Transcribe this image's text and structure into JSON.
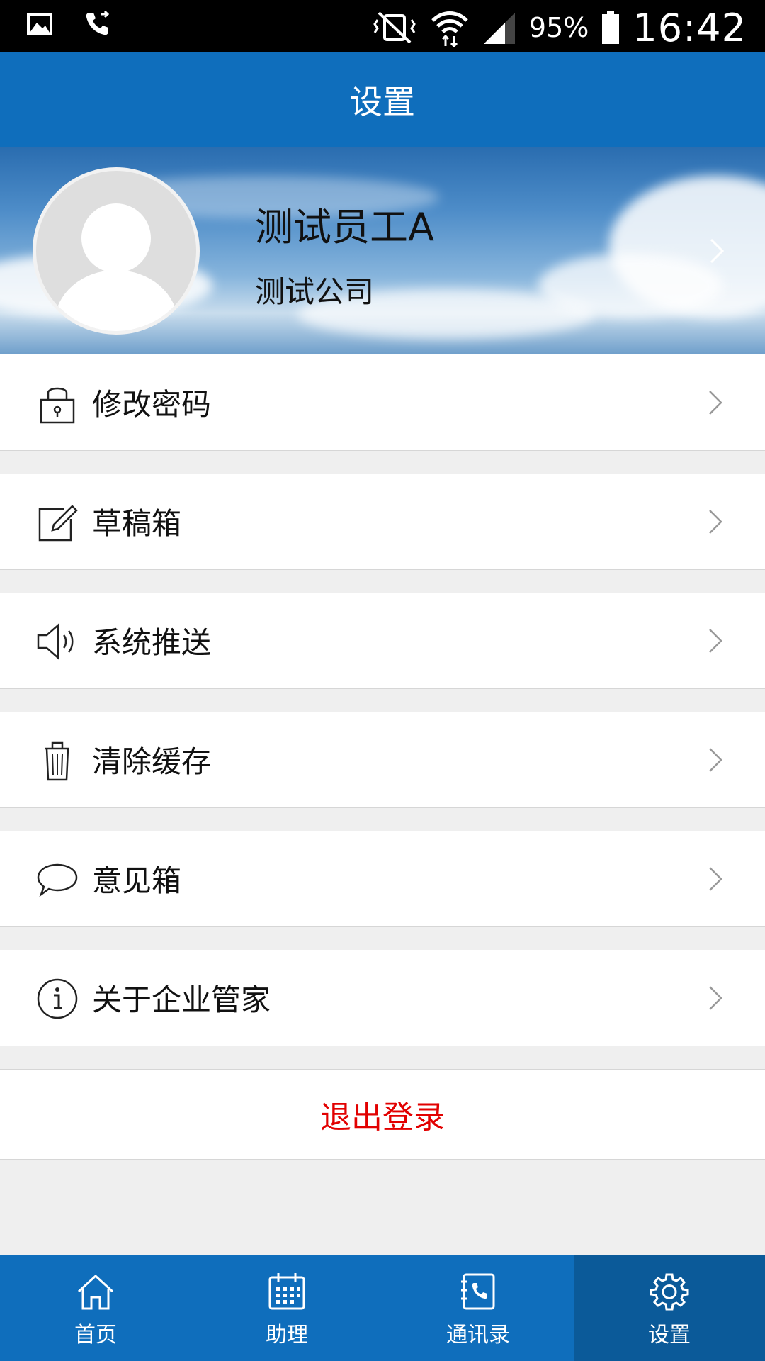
{
  "status_bar": {
    "battery": "95%",
    "time": "16:42"
  },
  "header": {
    "title": "设置"
  },
  "profile": {
    "name": "测试员工A",
    "company": "测试公司"
  },
  "menu": [
    {
      "label": "修改密码",
      "icon": "lock-icon"
    },
    {
      "label": "草稿箱",
      "icon": "edit-icon"
    },
    {
      "label": "系统推送",
      "icon": "speaker-icon"
    },
    {
      "label": "清除缓存",
      "icon": "trash-icon"
    },
    {
      "label": "意见箱",
      "icon": "chat-bubble-icon"
    },
    {
      "label": "关于企业管家",
      "icon": "info-icon"
    }
  ],
  "logout": {
    "label": "退出登录",
    "color": "#e20000"
  },
  "tabs": [
    {
      "label": "首页",
      "icon": "home-icon"
    },
    {
      "label": "助理",
      "icon": "calendar-icon"
    },
    {
      "label": "通讯录",
      "icon": "contacts-icon"
    },
    {
      "label": "设置",
      "icon": "gear-icon",
      "active": true
    }
  ],
  "colors": {
    "primary": "#0f6ebc",
    "active_tab": "#0b5a99",
    "background": "#efefef"
  }
}
